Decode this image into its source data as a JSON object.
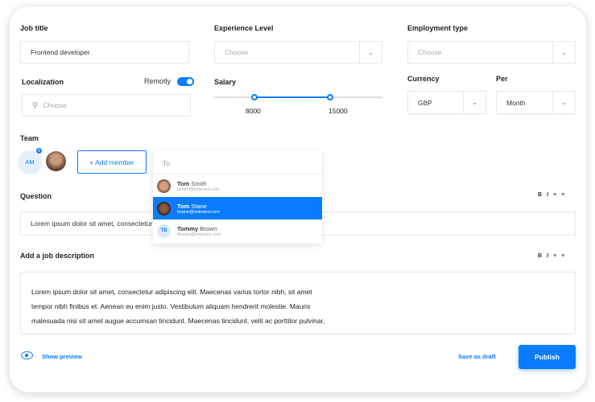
{
  "job_title": {
    "label": "Job title",
    "value": "Frontend developer"
  },
  "experience": {
    "label": "Experience Level",
    "placeholder": "Choose"
  },
  "employment": {
    "label": "Employment type",
    "placeholder": "Choose"
  },
  "localization": {
    "label": "Localization",
    "remote_label": "Remotly",
    "remote_on": true,
    "placeholder": "Choose"
  },
  "salary": {
    "label": "Salary",
    "min": "8000",
    "max": "15000"
  },
  "currency": {
    "label": "Currency",
    "value": "GBP"
  },
  "per": {
    "label": "Per",
    "value": "Month"
  },
  "team": {
    "label": "Team",
    "member_initials": "AM",
    "badge": "8",
    "add_label": "+ Add member"
  },
  "dropdown": {
    "placeholder": "To",
    "items": [
      {
        "first": "Tom",
        "last": " Smith",
        "email": "tsmith@onboard.com"
      },
      {
        "first": "Tom",
        "last": " Stane",
        "email": "tstane@onboard.com"
      },
      {
        "first": "Tommy",
        "last": " Brown",
        "email": "tbrown@onboard.com",
        "initials": "TB"
      }
    ]
  },
  "question": {
    "label": "Question",
    "value": "Lorem ipsum dolor sit amet, consectetur adipiscing elit."
  },
  "toolbar": {
    "bold": "B",
    "italic": "I"
  },
  "description": {
    "label": "Add a job description",
    "lines": [
      "Lorem ipsum dolor sit amet, consectetur adipiscing elit. Maecenas varius tortor nibh, sit amet",
      "tempor nibh finibus et. Aenean eu enim justo. Vestibulum aliquam hendrerit molestie. Mauris",
      "malesuada nisi sit amet augue accumsan tincidunt. Maecenas tincidunt, velit ac porttitor pulvinar,"
    ]
  },
  "footer": {
    "preview": "Show preview",
    "draft": "Save as draft",
    "publish": "Publish"
  },
  "colors": {
    "accent": "#0a7cff"
  }
}
